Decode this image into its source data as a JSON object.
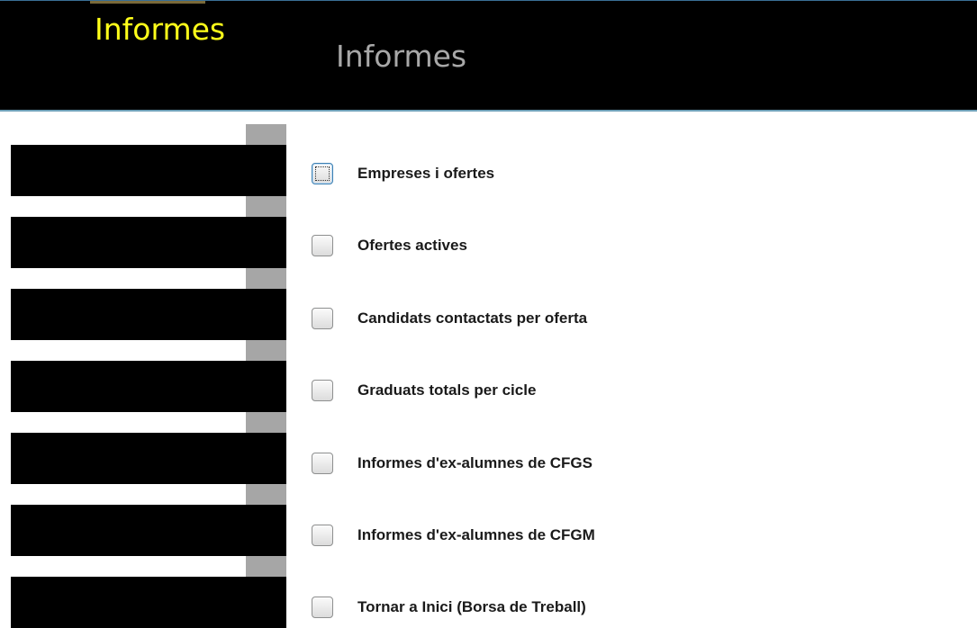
{
  "header": {
    "brand": "Informes",
    "title": "Informes"
  },
  "sidebar": {
    "items": [
      "",
      "",
      "",
      "",
      "",
      "",
      ""
    ]
  },
  "options": [
    {
      "label": "Empreses i ofertes",
      "checked": false,
      "focused": true
    },
    {
      "label": "Ofertes actives",
      "checked": false,
      "focused": false
    },
    {
      "label": "Candidats contactats per oferta",
      "checked": false,
      "focused": false
    },
    {
      "label": "Graduats totals per cicle",
      "checked": false,
      "focused": false
    },
    {
      "label": "Informes d'ex-alumnes de CFGS",
      "checked": false,
      "focused": false
    },
    {
      "label": "Informes d'ex-alumnes de CFGM",
      "checked": false,
      "focused": false
    },
    {
      "label": "Tornar a Inici (Borsa de Treball)",
      "checked": false,
      "focused": false
    }
  ],
  "colors": {
    "header_bg": "#000000",
    "brand": "#ffff1a",
    "title": "#a8a8a8",
    "sidebar_item": "#000000",
    "scrollbar": "#a6a6a6",
    "focus_border": "#3c7fb1"
  }
}
